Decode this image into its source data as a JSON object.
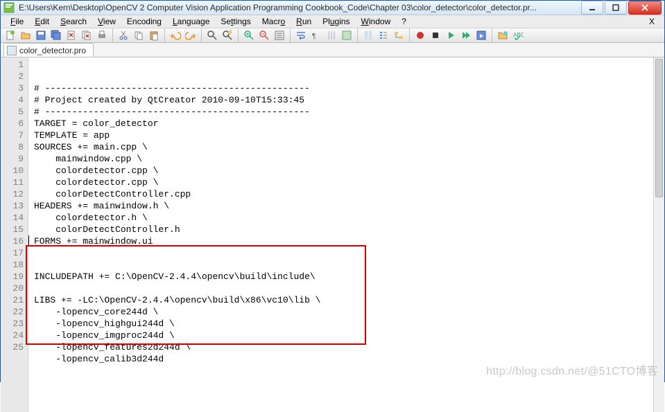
{
  "window": {
    "title": "E:\\Users\\Kern\\Desktop\\OpenCV 2 Computer Vision Application Programming Cookbook_Code\\Chapter 03\\color_detector\\color_detector.pr..."
  },
  "menu": {
    "file": "File",
    "edit": "Edit",
    "search": "Search",
    "view": "View",
    "encoding": "Encoding",
    "language": "Language",
    "settings": "Settings",
    "macro": "Macro",
    "run": "Run",
    "plugins": "Plugins",
    "window": "Window",
    "help": "?",
    "x": "X"
  },
  "tabs": {
    "items": [
      {
        "label": "color_detector.pro"
      }
    ]
  },
  "editor": {
    "lines": [
      "# -------------------------------------------------",
      "# Project created by QtCreator 2010-09-10T15:33:45",
      "# -------------------------------------------------",
      "TARGET = color_detector",
      "TEMPLATE = app",
      "SOURCES += main.cpp \\",
      "    mainwindow.cpp \\",
      "    colordetector.cpp \\",
      "    colordetector.cpp \\",
      "    colorDetectController.cpp",
      "HEADERS += mainwindow.h \\",
      "    colordetector.h \\",
      "    colorDetectController.h",
      "FORMS += mainwindow.ui",
      "",
      "",
      "INCLUDEPATH += C:\\OpenCV-2.4.4\\opencv\\build\\include\\",
      "",
      "LIBS += -LC:\\OpenCV-2.4.4\\opencv\\build\\x86\\vc10\\lib \\",
      "    -lopencv_core244d \\",
      "    -lopencv_highgui244d \\",
      "    -lopencv_imgproc244d \\",
      "    -lopencv_features2d244d \\",
      "    -lopencv_calib3d244d",
      ""
    ]
  },
  "watermark": "http://blog.csdn.net/@51CTO博客"
}
